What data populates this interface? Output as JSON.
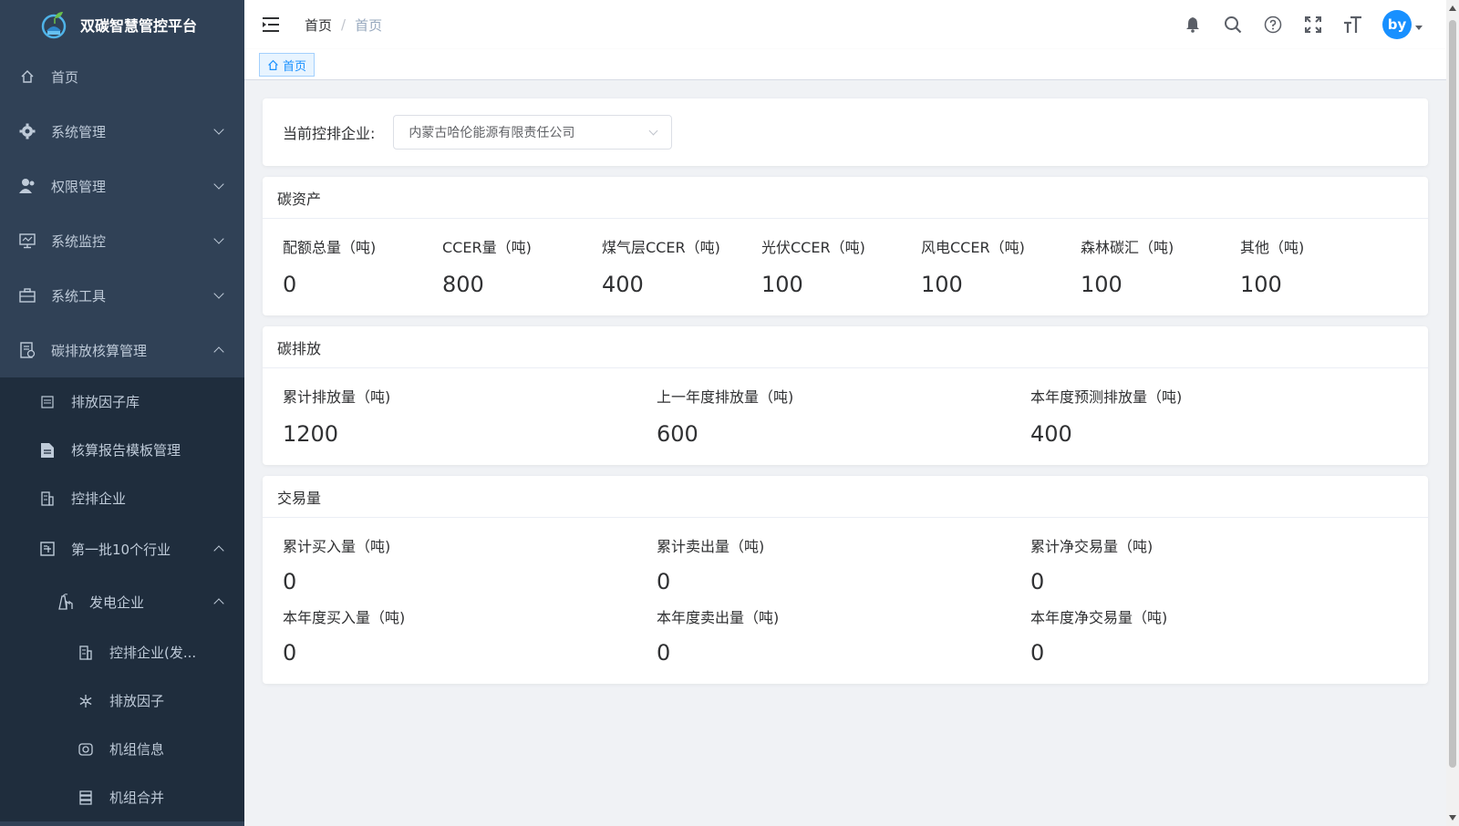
{
  "app": {
    "title": "双碳智慧管控平台"
  },
  "sidebar": {
    "items": [
      {
        "label": "首页",
        "icon": "home-icon"
      },
      {
        "label": "系统管理",
        "icon": "gear-icon"
      },
      {
        "label": "权限管理",
        "icon": "user-icon"
      },
      {
        "label": "系统监控",
        "icon": "monitor-icon"
      },
      {
        "label": "系统工具",
        "icon": "toolbox-icon"
      },
      {
        "label": "碳排放核算管理",
        "icon": "report-icon"
      }
    ],
    "sub": {
      "factor_lib": "排放因子库",
      "template": "核算报告模板管理",
      "enterprise": "控排企业",
      "industry_group": "第一批10个行业",
      "power": "发电企业",
      "power_enterprise": "控排企业(发...",
      "emission_factor": "排放因子",
      "unit_info": "机组信息",
      "unit_merge": "机组合并"
    }
  },
  "header": {
    "breadcrumb": [
      "首页",
      "首页"
    ],
    "breadcrumb_sep": "/"
  },
  "tags": {
    "active": "首页"
  },
  "filter": {
    "label": "当前控排企业:",
    "selected": "内蒙古哈伦能源有限责任公司"
  },
  "carbon_assets": {
    "title": "碳资产",
    "stats": [
      {
        "label": "配额总量（吨)",
        "value": "0"
      },
      {
        "label": "CCER量（吨)",
        "value": "800"
      },
      {
        "label": "煤气层CCER（吨)",
        "value": "400"
      },
      {
        "label": "光伏CCER（吨)",
        "value": "100"
      },
      {
        "label": "风电CCER（吨)",
        "value": "100"
      },
      {
        "label": "森林碳汇（吨)",
        "value": "100"
      },
      {
        "label": "其他（吨)",
        "value": "100"
      }
    ]
  },
  "carbon_emission": {
    "title": "碳排放",
    "stats": [
      {
        "label": "累计排放量（吨)",
        "value": "1200"
      },
      {
        "label": "上一年度排放量（吨)",
        "value": "600"
      },
      {
        "label": "本年度预测排放量（吨)",
        "value": "400"
      }
    ]
  },
  "trading": {
    "title": "交易量",
    "stats": [
      {
        "label": "累计买入量（吨)",
        "value": "0"
      },
      {
        "label": "累计卖出量（吨)",
        "value": "0"
      },
      {
        "label": "累计净交易量（吨)",
        "value": "0"
      },
      {
        "label": "本年度买入量（吨)",
        "value": "0"
      },
      {
        "label": "本年度卖出量（吨)",
        "value": "0"
      },
      {
        "label": "本年度净交易量（吨)",
        "value": "0"
      }
    ]
  },
  "user": {
    "avatar_text": "by"
  },
  "colors": {
    "sidebar_bg": "#304156",
    "submenu_bg": "#1f2d3d",
    "accent": "#1890ff",
    "page_bg": "#f0f2f5"
  }
}
